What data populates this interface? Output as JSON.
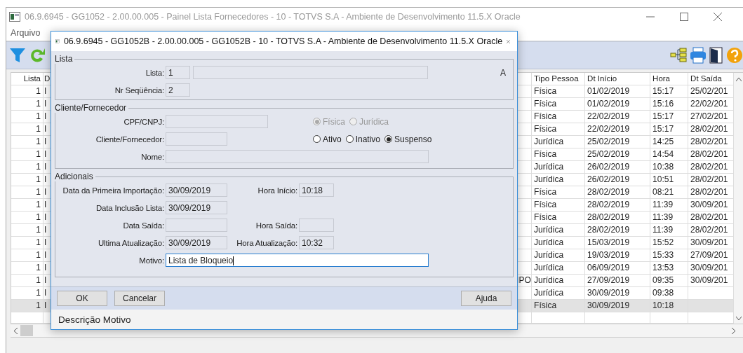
{
  "window": {
    "title": "06.9.6945 - GG1052 - 2.00.00.005 - Painel Lista Fornecedores - 10 - TOTVS S.A - Ambiente de Desenvolvimento 11.5.X Oracle"
  },
  "menu": [
    {
      "label": "Arquivo"
    }
  ],
  "table": {
    "left_columns": [
      "Lista",
      "D"
    ],
    "right_columns": [
      "Tipo Pessoa",
      "Dt Início",
      "Hora",
      "Dt Saída"
    ],
    "rows": [
      {
        "lista": "1",
        "column_2": "I",
        "tipo": "Física",
        "inicio": "01/02/2019",
        "hora": "15:17",
        "saida": "25/02/201",
        "selected": false
      },
      {
        "lista": "1",
        "column_2": "I",
        "tipo": "Física",
        "inicio": "01/02/2019",
        "hora": "15:16",
        "saida": "22/02/201",
        "selected": false
      },
      {
        "lista": "1",
        "column_2": "I",
        "tipo": "Física",
        "inicio": "22/02/2019",
        "hora": "15:17",
        "saida": "27/02/201",
        "selected": false
      },
      {
        "lista": "1",
        "column_2": "I",
        "tipo": "Física",
        "inicio": "22/02/2019",
        "hora": "15:17",
        "saida": "28/02/201",
        "selected": false
      },
      {
        "lista": "1",
        "column_2": "I",
        "tipo": "Jurídica",
        "inicio": "25/02/2019",
        "hora": "14:25",
        "saida": "28/02/201",
        "selected": false
      },
      {
        "lista": "1",
        "column_2": "I",
        "tipo": "Física",
        "inicio": "25/02/2019",
        "hora": "14:54",
        "saida": "28/02/201",
        "selected": false
      },
      {
        "lista": "1",
        "column_2": "I",
        "tipo": "Jurídica",
        "inicio": "26/02/2019",
        "hora": "10:38",
        "saida": "28/02/201",
        "selected": false
      },
      {
        "lista": "1",
        "column_2": "I",
        "tipo": "Jurídica",
        "inicio": "26/02/2019",
        "hora": "10:51",
        "saida": "28/02/201",
        "selected": false
      },
      {
        "lista": "1",
        "column_2": "I",
        "tipo": "Física",
        "inicio": "28/02/2019",
        "hora": "08:21",
        "saida": "28/02/201",
        "selected": false
      },
      {
        "lista": "1",
        "column_2": "I",
        "tipo": "Física",
        "inicio": "28/02/2019",
        "hora": "11:39",
        "saida": "30/09/201",
        "selected": false
      },
      {
        "lista": "1",
        "column_2": "I",
        "tipo": "Física",
        "inicio": "28/02/2019",
        "hora": "11:39",
        "saida": "28/02/201",
        "selected": false
      },
      {
        "lista": "1",
        "column_2": "I",
        "tipo": "Jurídica",
        "inicio": "28/02/2019",
        "hora": "11:39",
        "saida": "28/02/201",
        "selected": false
      },
      {
        "lista": "1",
        "column_2": "I",
        "tipo": "Jurídica",
        "inicio": "15/03/2019",
        "hora": "15:52",
        "saida": "30/09/201",
        "selected": false
      },
      {
        "lista": "1",
        "column_2": "I",
        "tipo": "Jurídica",
        "inicio": "19/03/2019",
        "hora": "15:33",
        "saida": "27/09/201",
        "selected": false
      },
      {
        "lista": "1",
        "column_2": "I",
        "tipo": "Jurídica",
        "inicio": "06/09/2019",
        "hora": "13:53",
        "saida": "30/09/201",
        "selected": false
      },
      {
        "lista": "1",
        "column_2": "I",
        "column_3": "IPO",
        "tipo": "Jurídica",
        "inicio": "27/09/2019",
        "hora": "09:35",
        "saida": "30/09/201",
        "selected": false
      },
      {
        "lista": "1",
        "column_2": "I",
        "tipo": "Jurídica",
        "inicio": "30/09/2019",
        "hora": "09:38",
        "selected": false
      },
      {
        "lista": "1",
        "column_2": "I",
        "tipo": "Física",
        "inicio": "30/09/2019",
        "hora": "10:18",
        "selected": true
      }
    ]
  },
  "dialog": {
    "title": "06.9.6945 - GG1052B - 2.00.00.005 - GG1052B - 10 - TOTVS S.A - Ambiente de Desenvolvimento 11.5.X Oracle",
    "lista_group": {
      "title": "Lista",
      "lista": {
        "label": "Lista:",
        "value": "1"
      },
      "flag": "A",
      "nr_sequencia": {
        "label": "Nr Seqüência:",
        "value": "2"
      }
    },
    "cliente_group": {
      "title": "Cliente/Fornecedor",
      "cpf_cnpj": {
        "label": "CPF/CNPJ:"
      },
      "pessoa_options": [
        {
          "label": "Física",
          "selected": true,
          "disabled": true
        },
        {
          "label": "Jurídica",
          "selected": false,
          "disabled": true
        }
      ],
      "cliente_fornecedor": {
        "label": "Cliente/Fornecedor:"
      },
      "status_options": [
        {
          "label": "Ativo",
          "selected": false,
          "disabled": false
        },
        {
          "label": "Inativo",
          "selected": false,
          "disabled": false
        },
        {
          "label": "Suspenso",
          "selected": true,
          "disabled": false
        }
      ],
      "nome": {
        "label": "Nome:"
      }
    },
    "adicionais_group": {
      "title": "Adicionais",
      "data_primeira_importacao": {
        "label": "Data da Primeira Importação:",
        "value": "30/09/2019"
      },
      "hora_inicio": {
        "label": "Hora Início:",
        "value": "10:18"
      },
      "data_inclusao_lista": {
        "label": "Data Inclusão Lista:",
        "value": "30/09/2019"
      },
      "data_saida": {
        "label": "Data Saída:"
      },
      "hora_saida": {
        "label": "Hora Saída:"
      },
      "ultima_atualizacao": {
        "label": "Ultima Atualização:",
        "value": "30/09/2019"
      },
      "hora_atualizacao": {
        "label": "Hora Atualização:",
        "value": "10:32"
      },
      "motivo": {
        "label": "Motivo:",
        "value": "Lista de Bloqueio"
      }
    },
    "buttons": [
      {
        "label": "OK"
      },
      {
        "label": "Cancelar"
      },
      {
        "label": "Ajuda"
      }
    ],
    "status_text": "Descrição Motivo"
  }
}
